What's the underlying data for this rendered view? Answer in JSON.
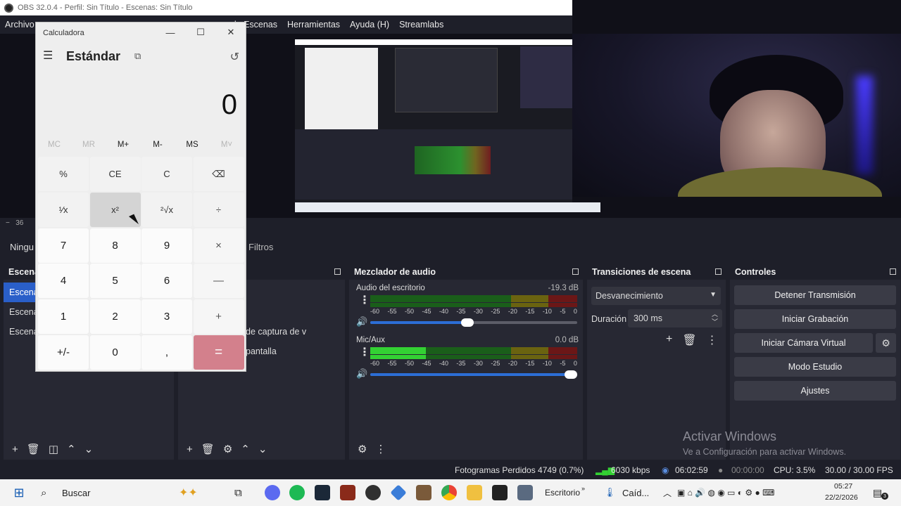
{
  "obs": {
    "title": "OBS 32.0.4 - Perfil: Sin Título - Escenas: Sin Título",
    "menu": [
      "Archivo",
      "de Escenas",
      "Herramientas",
      "Ayuda (H)",
      "Streamlabs"
    ],
    "zoom_prefix": "−",
    "zoom_value": "36",
    "source_toolbar": {
      "none_label": "Ningu",
      "filters_label": "Filtros"
    },
    "scenes": {
      "title": "Escena",
      "items": [
        "Escena",
        "Escena",
        "Escena"
      ]
    },
    "sources": {
      "items": [
        "",
        "",
        "de captura de v",
        "pantalla"
      ]
    },
    "mixer": {
      "title": "Mezclador de audio",
      "ticks": [
        "-60",
        "-55",
        "-50",
        "-45",
        "-40",
        "-35",
        "-30",
        "-25",
        "-20",
        "-15",
        "-10",
        "-5",
        "0"
      ],
      "channels": [
        {
          "name": "Audio del escritorio",
          "db": "-19.3 dB",
          "level": 0.0,
          "volume": 0.5
        },
        {
          "name": "Mic/Aux",
          "db": "0.0 dB",
          "level": 0.27,
          "volume": 1.0
        }
      ]
    },
    "transitions": {
      "title": "Transiciones de escena",
      "selected": "Desvanecimiento",
      "duration_label": "Duración",
      "duration_value": "300 ms"
    },
    "controls": {
      "title": "Controles",
      "buttons": [
        "Detener Transmisión",
        "Iniciar Grabación",
        "Iniciar Cámara Virtual",
        "Modo Estudio",
        "Ajustes"
      ]
    },
    "watermark": {
      "line1": "Activar Windows",
      "line2": "Ve a Configuración para activar Windows."
    },
    "status": {
      "dropped": "Fotogramas Perdidos 4749 (0.7%)",
      "kbps": "6030 kbps",
      "stream_time": "06:02:59",
      "rec_time": "00:00:00",
      "cpu": "CPU: 3.5%",
      "fps": "30.00 / 30.00 FPS"
    }
  },
  "calculator": {
    "title": "Calculadora",
    "mode": "Estándar",
    "display": "0",
    "memory": [
      {
        "label": "MC",
        "enabled": false
      },
      {
        "label": "MR",
        "enabled": false
      },
      {
        "label": "M+",
        "enabled": true
      },
      {
        "label": "M-",
        "enabled": true
      },
      {
        "label": "MS",
        "enabled": true
      },
      {
        "label": "M˅",
        "enabled": false
      }
    ],
    "keys": [
      [
        "%",
        "CE",
        "C",
        "⌫"
      ],
      [
        "¹⁄x",
        "x²",
        "²√x",
        "÷"
      ],
      [
        "7",
        "8",
        "9",
        "×"
      ],
      [
        "4",
        "5",
        "6",
        "—"
      ],
      [
        "1",
        "2",
        "3",
        "+"
      ],
      [
        "+/-",
        "0",
        ",",
        "="
      ]
    ]
  },
  "taskbar": {
    "search": "Buscar",
    "desktop_label": "Escritorio",
    "weather": "Caíd...",
    "time": "05:27",
    "date": "22/2/2026",
    "notification_count": "3"
  },
  "colors": {
    "accent": "#2a5fc9",
    "equals": "#d3808c",
    "dock_bg": "#272833"
  }
}
